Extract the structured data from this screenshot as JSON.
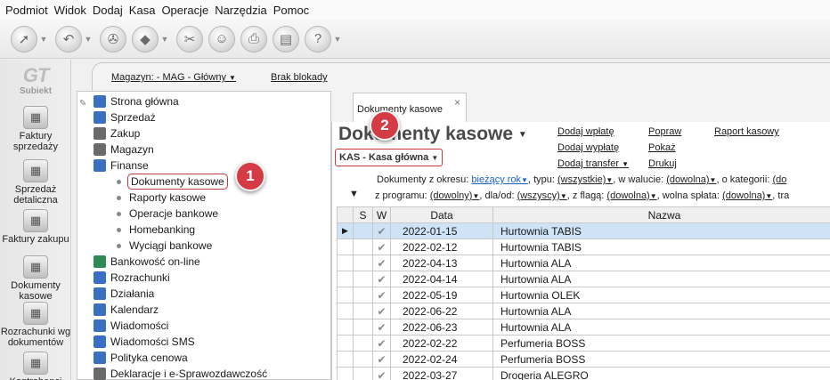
{
  "menu": [
    "Podmiot",
    "Widok",
    "Dodaj",
    "Kasa",
    "Operacje",
    "Narzędzia",
    "Pomoc"
  ],
  "toolbar_icons": [
    "cursor-icon",
    "back-icon",
    "stamp-icon",
    "eraser-icon",
    "tools-icon",
    "people-icon",
    "printer-icon",
    "notebook-icon",
    "help-icon"
  ],
  "logo": {
    "mark": "GT",
    "name": "Subiekt"
  },
  "leftbar": [
    {
      "label": "Faktury sprzedaży",
      "icon": "coins-icon"
    },
    {
      "label": "Sprzedaż detaliczna",
      "icon": "register-icon"
    },
    {
      "label": "Faktury zakupu",
      "icon": "invoice-icon"
    },
    {
      "label": "Dokumenty kasowe",
      "icon": "cash-icon"
    },
    {
      "label": "Rozrachunki wg dokumentów",
      "icon": "settlements-icon"
    },
    {
      "label": "Kontrahenci",
      "icon": "person-icon"
    }
  ],
  "magbar": {
    "magazyn": "Magazyn: - MAG - Główny",
    "blokada": "Brak blokady"
  },
  "tree": [
    {
      "label": "Strona główna",
      "type": "root",
      "icon": "home-icon"
    },
    {
      "label": "Sprzedaż",
      "type": "root",
      "icon": "sales-icon"
    },
    {
      "label": "Zakup",
      "type": "root",
      "icon": "purchase-icon"
    },
    {
      "label": "Magazyn",
      "type": "root",
      "icon": "warehouse-icon"
    },
    {
      "label": "Finanse",
      "type": "root",
      "icon": "finance-icon"
    },
    {
      "label": "Dokumenty kasowe",
      "type": "sub",
      "selected": true
    },
    {
      "label": "Raporty kasowe",
      "type": "sub"
    },
    {
      "label": "Operacje bankowe",
      "type": "sub"
    },
    {
      "label": "Homebanking",
      "type": "sub"
    },
    {
      "label": "Wyciągi bankowe",
      "type": "sub"
    },
    {
      "label": "Bankowość on-line",
      "type": "root",
      "icon": "bank-icon"
    },
    {
      "label": "Rozrachunki",
      "type": "root",
      "icon": "settlements-icon"
    },
    {
      "label": "Działania",
      "type": "root",
      "icon": "actions-icon"
    },
    {
      "label": "Kalendarz",
      "type": "root",
      "icon": "calendar-icon"
    },
    {
      "label": "Wiadomości",
      "type": "root",
      "icon": "mail-icon"
    },
    {
      "label": "Wiadomości SMS",
      "type": "root",
      "icon": "sms-icon"
    },
    {
      "label": "Polityka cenowa",
      "type": "root",
      "icon": "price-icon"
    },
    {
      "label": "Deklaracje i e-Sprawozdawczość",
      "type": "root",
      "icon": "declaration-icon"
    }
  ],
  "tab": {
    "label": "Dokumenty kasowe",
    "close": "×"
  },
  "main": {
    "title": "Dokumenty kasowe",
    "kas": "KAS - Kasa główna",
    "actions": {
      "dodaj_wplate": "Dodaj wpłatę",
      "dodaj_wyplate": "Dodaj wypłatę",
      "dodaj_transfer": "Dodaj transfer",
      "popraw": "Popraw",
      "pokaz": "Pokaż",
      "drukuj": "Drukuj",
      "raport": "Raport kasowy"
    }
  },
  "filters": {
    "okres_label": "Dokumenty z okresu:",
    "okres_value": "bieżący rok",
    "typ_label": ", typu:",
    "typ_value": "(wszystkie)",
    "waluta_label": ", w walucie:",
    "waluta_value": "(dowolna)",
    "kategoria_label": ", o kategorii:",
    "kategoria_value": "(do",
    "program_label": "z programu:",
    "program_value": "(dowolny)",
    "dla_label": ", dla/od:",
    "dla_value": "(wszyscy)",
    "flaga_label": ", z flagą:",
    "flaga_value": "(dowolna)",
    "splata_label": ", wolna spłata:",
    "splata_value": "(dowolna)",
    "tail": ", tra"
  },
  "table": {
    "headers": {
      "s": "S",
      "w": "W",
      "data": "Data",
      "nazwa": "Nazwa"
    },
    "rows": [
      {
        "date": "2022-01-15",
        "name": "Hurtownia TABIS"
      },
      {
        "date": "2022-02-12",
        "name": "Hurtownia TABIS"
      },
      {
        "date": "2022-04-13",
        "name": "Hurtownia ALA"
      },
      {
        "date": "2022-04-14",
        "name": "Hurtownia ALA"
      },
      {
        "date": "2022-05-19",
        "name": "Hurtownia OLEK"
      },
      {
        "date": "2022-06-22",
        "name": "Hurtownia ALA"
      },
      {
        "date": "2022-06-23",
        "name": "Hurtownia ALA"
      },
      {
        "date": "2022-02-22",
        "name": "Perfumeria BOSS"
      },
      {
        "date": "2022-02-24",
        "name": "Perfumeria BOSS"
      },
      {
        "date": "2022-03-27",
        "name": "Drogeria ALEGRO"
      }
    ]
  },
  "callouts": [
    "1",
    "2"
  ]
}
